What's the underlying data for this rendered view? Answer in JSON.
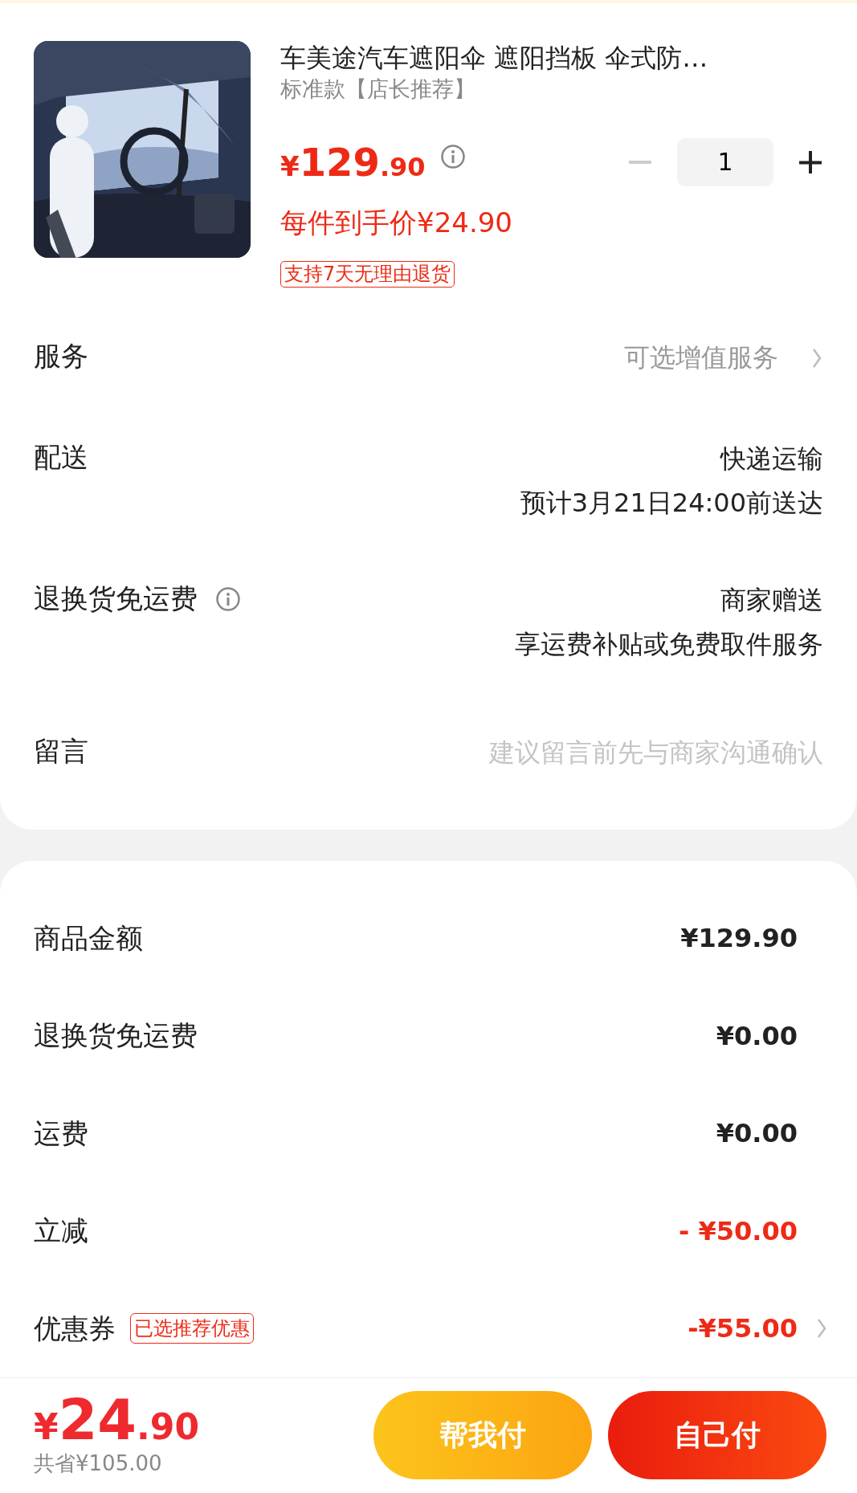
{
  "product": {
    "title": "车美途汽车遮阳伞 遮阳挡板 伞式防…",
    "spec": "标准款【店长推荐】",
    "price": {
      "currency": "¥",
      "integer": "129",
      "decimal": ".90"
    },
    "quantity": "1",
    "decrease_disabled": true,
    "unit_price": "每件到手价¥24.90",
    "tag": "支持7天无理由退货"
  },
  "order_rows": [
    {
      "kind": "select",
      "label": "服务",
      "info": false,
      "values": [
        "可选增值服务"
      ]
    },
    {
      "kind": "text",
      "label": "配送",
      "info": false,
      "values": [
        "快递运输",
        "预计3月21日24:00前送达"
      ]
    },
    {
      "kind": "text",
      "label": "退换货免运费",
      "info": true,
      "values": [
        "商家赠送",
        "享运费补贴或免费取件服务"
      ]
    },
    {
      "kind": "input",
      "label": "留言",
      "info": false,
      "placeholder": "建议留言前先与商家沟通确认"
    }
  ],
  "summary_rows": [
    {
      "label": "商品金额",
      "value": "¥129.90",
      "discount": false,
      "chevron": false
    },
    {
      "label": "退换货免运费",
      "value": "¥0.00",
      "discount": false,
      "chevron": false
    },
    {
      "label": "运费",
      "value": "¥0.00",
      "discount": false,
      "chevron": false
    },
    {
      "label": "立减",
      "value": "- ¥50.00",
      "discount": true,
      "chevron": false
    },
    {
      "label": "优惠券",
      "tag": "已选推荐优惠",
      "value": "-¥55.00",
      "discount": true,
      "chevron": true
    }
  ],
  "footer": {
    "total": {
      "currency": "¥",
      "integer": "24",
      "decimal": ".90"
    },
    "saved": "共省¥105.00",
    "buttons": [
      {
        "label": "帮我付",
        "kind": "secondary"
      },
      {
        "label": "自己付",
        "kind": "primary"
      }
    ]
  }
}
